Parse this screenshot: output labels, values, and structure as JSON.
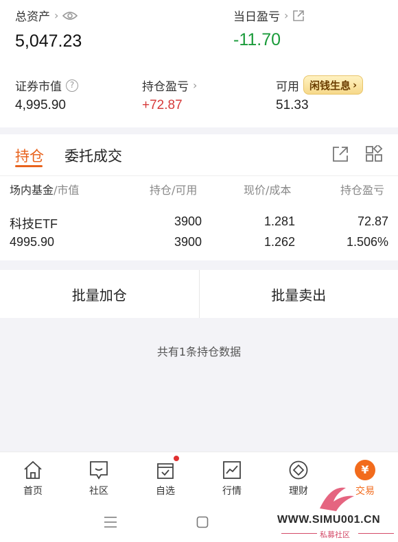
{
  "summary": {
    "total_assets_label": "总资产",
    "total_assets_value": "5,047.23",
    "daily_pnl_label": "当日盈亏",
    "daily_pnl_value": "-11.70",
    "securities_value_label": "证券市值",
    "securities_value": "4,995.90",
    "position_pnl_label": "持仓盈亏",
    "position_pnl_value": "+72.87",
    "available_label": "可用",
    "available_value": "51.33",
    "idle_interest_badge": "闲钱生息"
  },
  "holdings": {
    "tabs": [
      {
        "label": "持仓",
        "active": true
      },
      {
        "label": "委托成交",
        "active": false
      }
    ],
    "headers": {
      "col1_main": "场内基金",
      "col1_sub": "/市值",
      "col2": "持仓/可用",
      "col3": "现价/成本",
      "col4": "持仓盈亏"
    },
    "rows": [
      {
        "name": "科技ETF",
        "market_value": "4995.90",
        "position": "3900",
        "available": "3900",
        "price": "1.281",
        "cost": "1.262",
        "pnl": "72.87",
        "pnl_pct": "1.506%"
      }
    ]
  },
  "actions": {
    "batch_add": "批量加仓",
    "batch_sell": "批量卖出"
  },
  "position_count_text": "共有1条持仓数据",
  "nav": {
    "items": [
      {
        "label": "首页",
        "icon": "home-icon"
      },
      {
        "label": "社区",
        "icon": "chat-icon"
      },
      {
        "label": "自选",
        "icon": "watchlist-icon",
        "dot": true
      },
      {
        "label": "行情",
        "icon": "chart-icon"
      },
      {
        "label": "理财",
        "icon": "diamond-icon"
      },
      {
        "label": "交易",
        "icon": "trade-icon",
        "active": true
      }
    ]
  },
  "watermark": {
    "url": "WWW.SIMU001.CN",
    "sub": "私募社区"
  },
  "colors": {
    "accent": "#f26b1c",
    "up": "#d63a3a",
    "down": "#1a9b3a"
  }
}
